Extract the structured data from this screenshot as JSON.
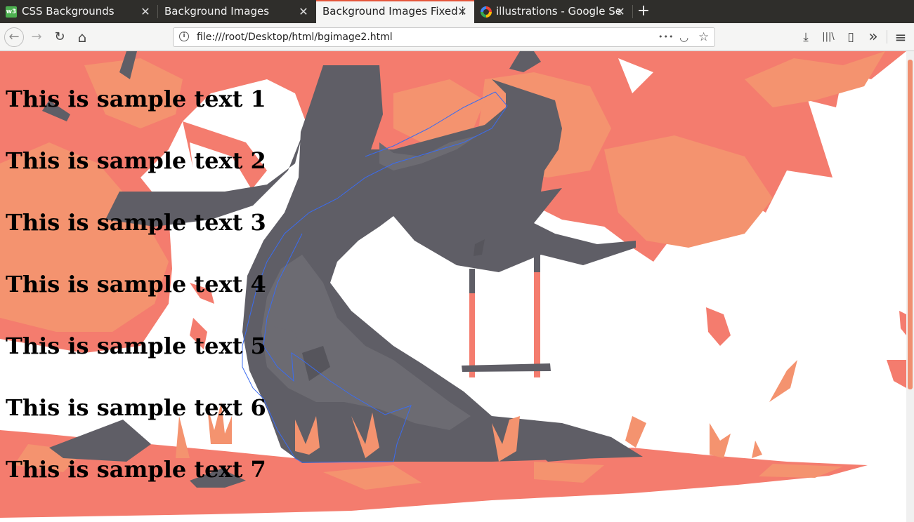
{
  "tabs": [
    {
      "title": "CSS Backgrounds",
      "favicon": "w3-icon",
      "active": false
    },
    {
      "title": "Background Images",
      "favicon": "none",
      "active": false
    },
    {
      "title": "Background Images Fixed i",
      "favicon": "none",
      "active": true
    },
    {
      "title": "illustrations - Google Se",
      "favicon": "google-icon",
      "active": false
    }
  ],
  "favicon_text": "w3",
  "new_tab_label": "+",
  "nav": {
    "back": "←",
    "forward": "→",
    "reload": "↻",
    "home": "⌂"
  },
  "urlbar": {
    "url": "file:///root/Desktop/html/bgimage2.html",
    "info_glyph": "i",
    "more_glyph": "•••",
    "pocket_glyph": "◡",
    "star_glyph": "☆"
  },
  "toolbar_right": {
    "download": "⤓",
    "library": "|||\\",
    "sidebar": "▯",
    "overflow": "»",
    "menu": "≡"
  },
  "page": {
    "headings": [
      "This is sample text 1",
      "This is sample text 2",
      "This is sample text 3",
      "This is sample text 4",
      "This is sample text 5",
      "This is sample text 6",
      "This is sample text 7"
    ]
  },
  "colors": {
    "coral": "#f47c6e",
    "peach": "#f4936f",
    "trunk": "#5f5e66",
    "trunk_light": "#6c6b72",
    "accent": "#e4573c"
  }
}
